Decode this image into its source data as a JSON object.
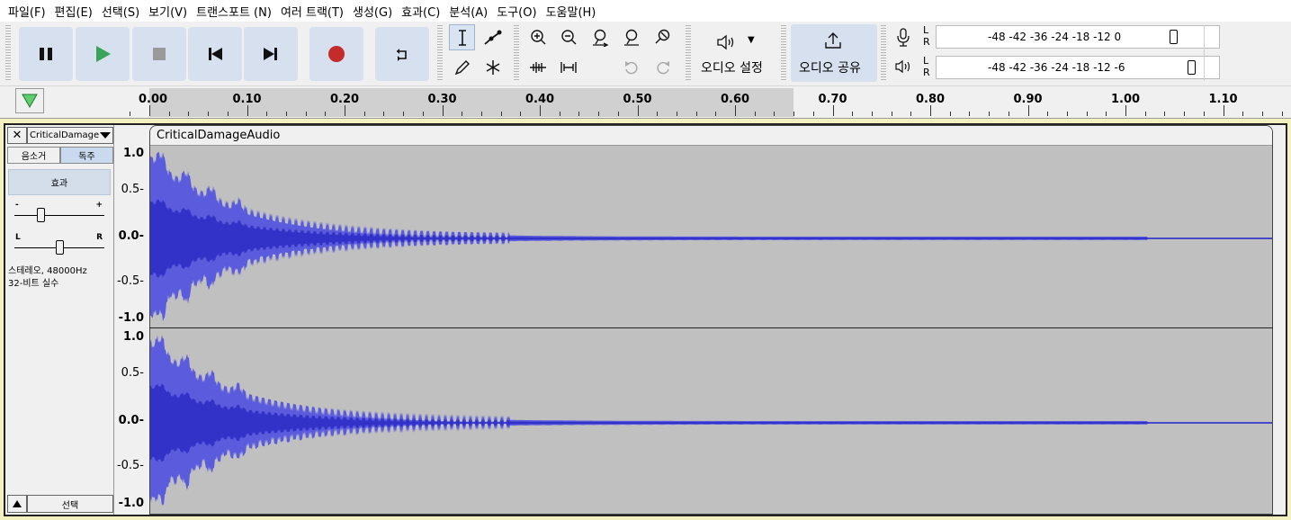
{
  "menu": [
    "파일(F)",
    "편집(E)",
    "선택(S)",
    "보기(V)",
    "트랜스포트 (N)",
    "여러 트랙(T)",
    "생성(G)",
    "효과(C)",
    "분석(A)",
    "도구(O)",
    "도움말(H)"
  ],
  "toolbar": {
    "audio_setup_label": "오디오 설정",
    "share_audio_label": "오디오 공유"
  },
  "meters": {
    "record": {
      "L": "L",
      "R": "R",
      "scale": "-48  -42  -36       -24  -18  -12    0"
    },
    "playback": {
      "L": "L",
      "R": "R",
      "scale": "-48  -42  -36       -24  -18  -12  -6"
    }
  },
  "ruler": {
    "labels": [
      "0.00",
      "0.10",
      "0.20",
      "0.30",
      "0.40",
      "0.50",
      "0.60",
      "0.70",
      "0.80",
      "0.90",
      "1.00",
      "1.10"
    ]
  },
  "track": {
    "name": "CriticalDamage",
    "clip_name": "CriticalDamageAudio",
    "mute_label": "음소거",
    "solo_label": "독주",
    "effects_label": "효과",
    "gain_minus": "-",
    "gain_plus": "+",
    "pan_left": "L",
    "pan_right": "R",
    "info_line1": "스테레오, 48000Hz",
    "info_line2": "32-비트 실수",
    "select_label": "선택",
    "channels": 2,
    "scale_labels": [
      "1.0",
      "0.5-",
      "0.0-",
      "-0.5-",
      "-1.0"
    ]
  },
  "colors": {
    "waveform": "#5b5bdd",
    "waveform_rms": "#3232c9",
    "clip_bg": "#c0c0c0",
    "track_highlight": "#f4f1c0",
    "button_bg": "#d6e0ee",
    "record_red": "#c42b2b",
    "play_green": "#3aa35a"
  }
}
